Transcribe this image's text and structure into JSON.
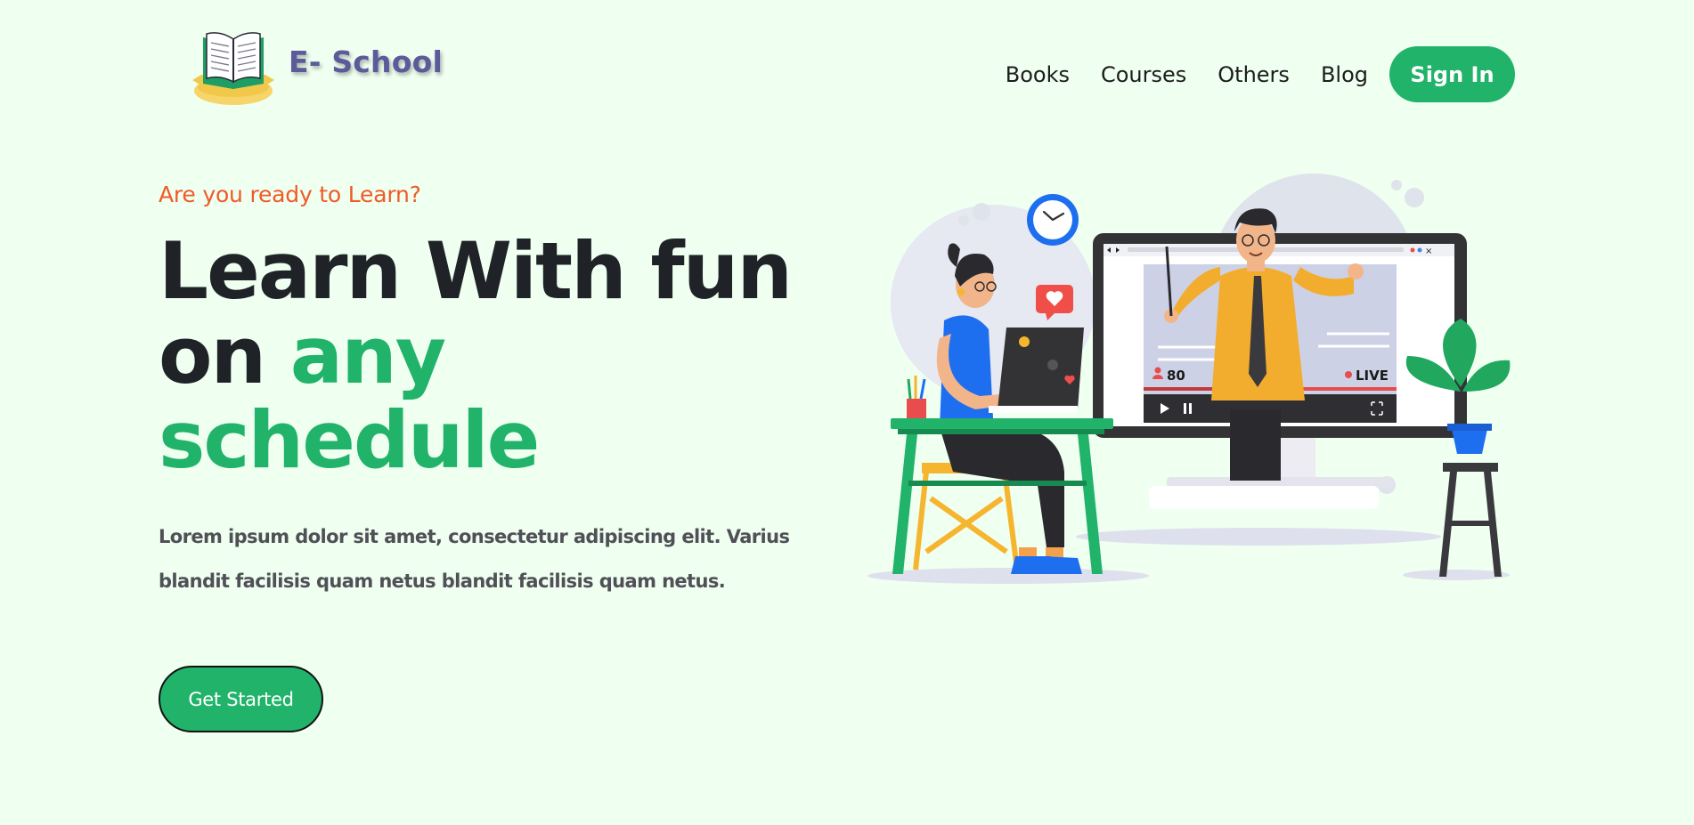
{
  "brand": {
    "name": "E- School",
    "logo_icon": "open-book-icon"
  },
  "nav": {
    "items": [
      {
        "label": "Books"
      },
      {
        "label": "Courses"
      },
      {
        "label": "Others"
      },
      {
        "label": "Blog"
      }
    ],
    "signin_label": "Sign In"
  },
  "hero": {
    "eyebrow": "Are you ready to Learn?",
    "headline_line1": "Learn With fun",
    "headline_on": "on ",
    "headline_highlight_1": "any",
    "headline_highlight_2": "schedule",
    "description": "Lorem ipsum dolor sit amet, consectetur adipiscing elit. Varius blandit facilisis quam netus blandit facilisis quam netus.",
    "cta_label": "Get Started"
  },
  "illustration": {
    "viewer_count": "80",
    "live_label": "LIVE"
  },
  "colors": {
    "background": "#effff0",
    "accent_green": "#21b36a",
    "eyebrow_orange": "#f05a28",
    "brand_purple": "#5b5a9a",
    "heading_dark": "#1f2328"
  }
}
